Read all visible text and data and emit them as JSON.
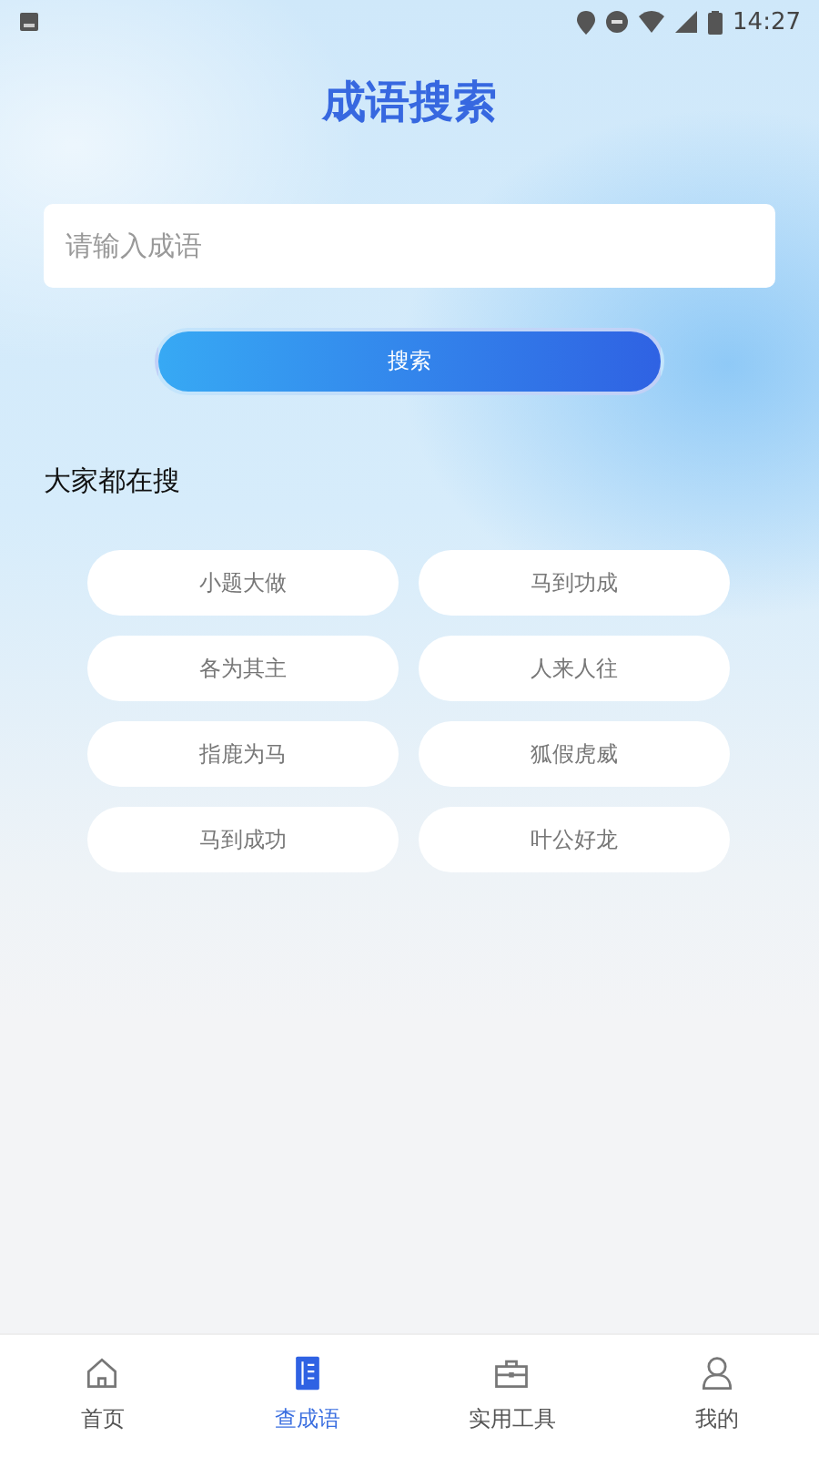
{
  "status_bar": {
    "time": "14:27"
  },
  "title": "成语搜索",
  "search": {
    "placeholder": "请输入成语",
    "button": "搜索"
  },
  "popular": {
    "heading": "大家都在搜",
    "items": [
      "小题大做",
      "马到功成",
      "各为其主",
      "人来人往",
      "指鹿为马",
      "狐假虎威",
      "马到成功",
      "叶公好龙"
    ]
  },
  "tabs": [
    {
      "label": "首页",
      "selected": false
    },
    {
      "label": "查成语",
      "selected": true
    },
    {
      "label": "实用工具",
      "selected": false
    },
    {
      "label": "我的",
      "selected": false
    }
  ]
}
